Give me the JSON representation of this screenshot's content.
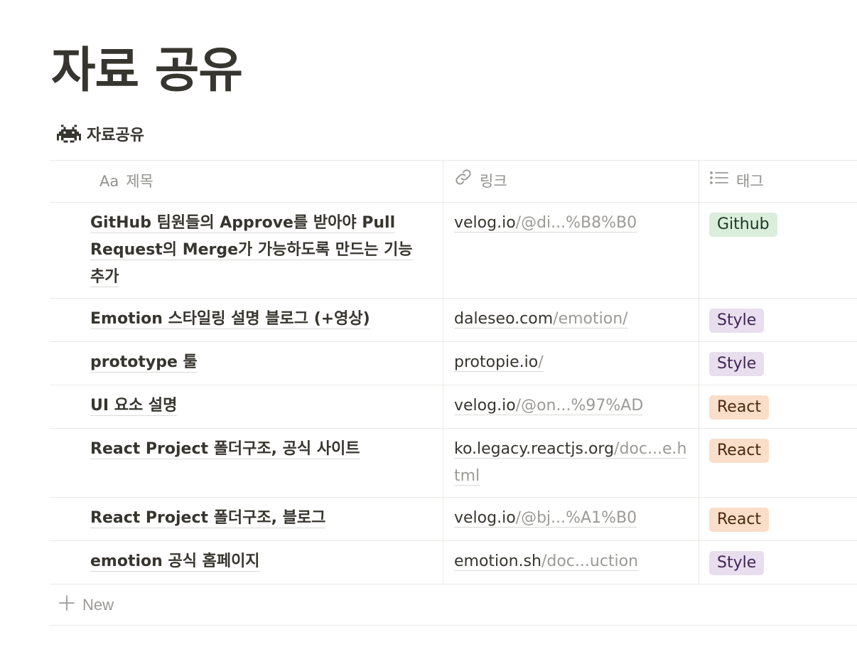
{
  "page": {
    "title": "자료 공유"
  },
  "database": {
    "title": "자료공유",
    "icon": "space-invader-icon"
  },
  "columns": {
    "title": {
      "label": "제목",
      "icon": "text-aa-icon",
      "icon_text": "Aa"
    },
    "link": {
      "label": "링크",
      "icon": "link-icon"
    },
    "tags": {
      "label": "태그",
      "icon": "list-icon"
    }
  },
  "rows": [
    {
      "title": "GitHub 팀원들의 Approve를 받아야 Pull Request의 Merge가 가능하도록 만드는 기능 추가",
      "link_host": "velog.io",
      "link_path": "/@di...%B8%B0",
      "tag": "Github",
      "tag_bg": "#dbeddb",
      "tag_fg": "#1c3829"
    },
    {
      "title": "Emotion 스타일링 설명 블로그 (+영상)",
      "link_host": "daleseo.com",
      "link_path": "/emotion/",
      "tag": "Style",
      "tag_bg": "#e8deee",
      "tag_fg": "#412454"
    },
    {
      "title": "prototype 툴",
      "link_host": "protopie.io",
      "link_path": "/",
      "tag": "Style",
      "tag_bg": "#e8deee",
      "tag_fg": "#412454"
    },
    {
      "title": "UI 요소 설명",
      "link_host": "velog.io",
      "link_path": "/@on...%97%AD",
      "tag": "React",
      "tag_bg": "#fadec9",
      "tag_fg": "#49290e"
    },
    {
      "title": "React Project 폴더구조, 공식 사이트",
      "link_host": "ko.legacy.reactjs.org",
      "link_path": "/doc...e.html",
      "tag": "React",
      "tag_bg": "#fadec9",
      "tag_fg": "#49290e"
    },
    {
      "title": "React Project 폴더구조, 블로그",
      "link_host": "velog.io",
      "link_path": "/@bj...%A1%B0",
      "tag": "React",
      "tag_bg": "#fadec9",
      "tag_fg": "#49290e"
    },
    {
      "title": "emotion 공식 홈페이지",
      "link_host": "emotion.sh",
      "link_path": "/doc...uction",
      "tag": "Style",
      "tag_bg": "#e8deee",
      "tag_fg": "#412454"
    }
  ],
  "new_row": {
    "label": "New",
    "icon": "plus-icon"
  }
}
